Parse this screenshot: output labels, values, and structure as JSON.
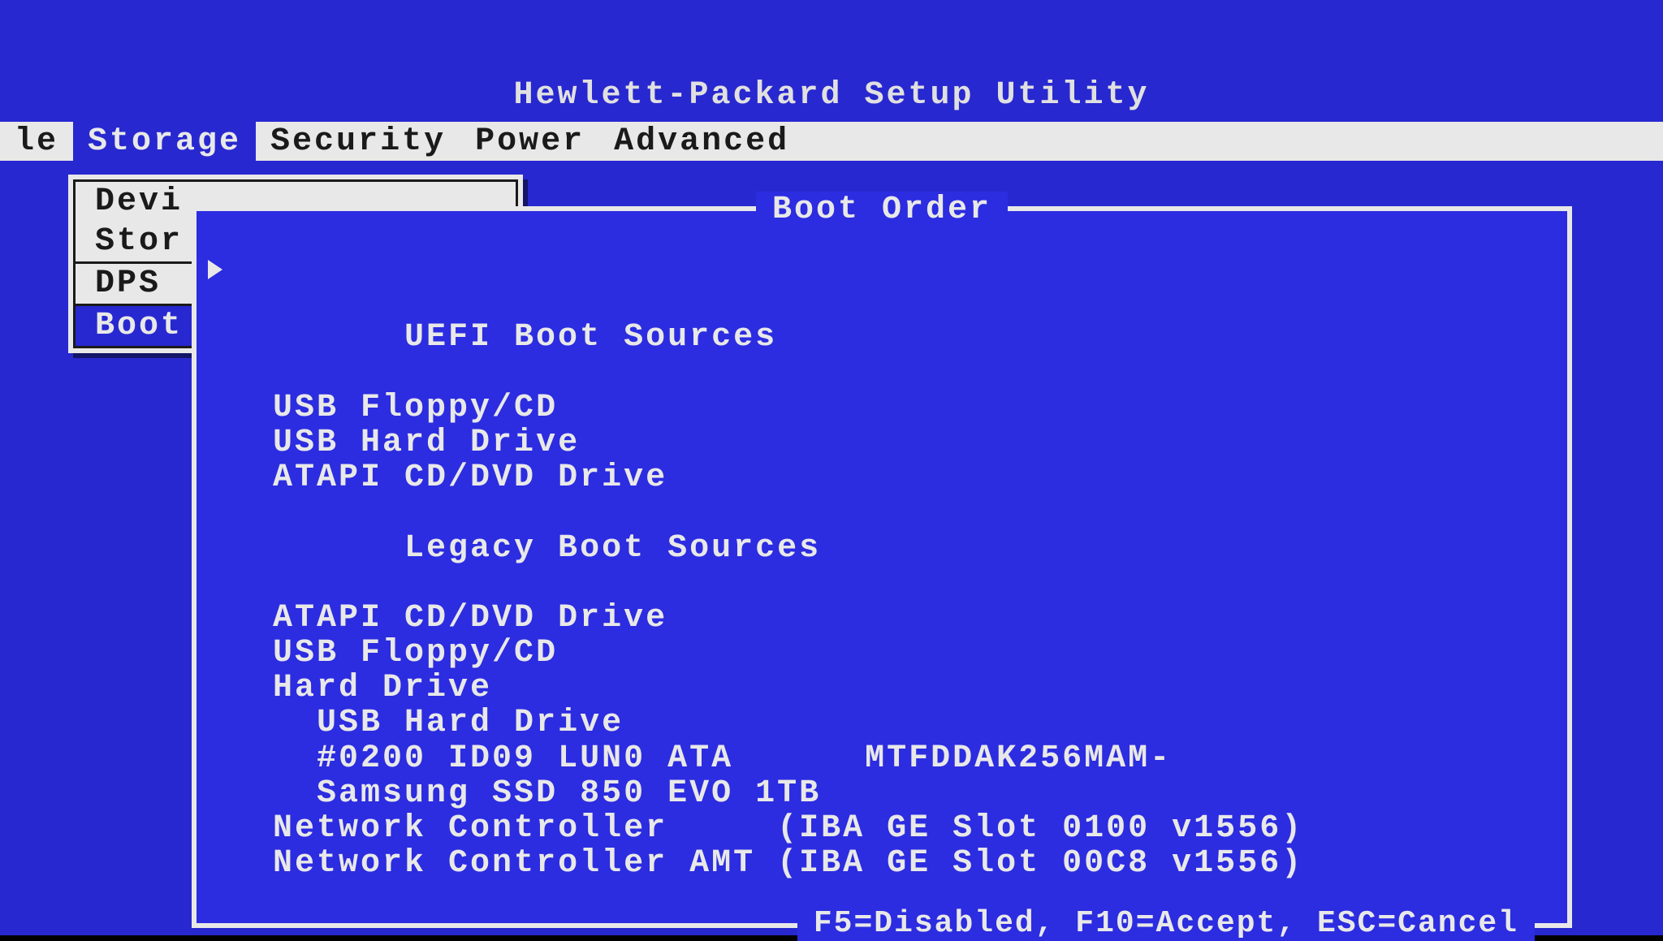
{
  "header": {
    "title": "Hewlett-Packard Setup Utility"
  },
  "menu": {
    "items": [
      "le",
      "Storage",
      "Security",
      "Power",
      "Advanced"
    ],
    "active_index": 1
  },
  "dropdown": {
    "items": [
      {
        "label": "Devi",
        "selected": false
      },
      {
        "label": "Stor",
        "selected": false
      },
      {
        "label": "DPS",
        "selected": false,
        "separator_before": true
      },
      {
        "label": "Boot",
        "selected": true,
        "separator_before": true
      }
    ]
  },
  "dialog": {
    "title": "Boot Order",
    "footer": "F5=Disabled, F10=Accept, ESC=Cancel",
    "groups": [
      {
        "label": "UEFI Boot Sources",
        "has_arrow": true,
        "items": [
          "USB Floppy/CD",
          "USB Hard Drive",
          "ATAPI CD/DVD Drive"
        ]
      },
      {
        "label": "Legacy Boot Sources",
        "has_arrow": false,
        "items": [
          "ATAPI CD/DVD Drive",
          "USB Floppy/CD",
          "Hard Drive",
          "  USB Hard Drive",
          "  #0200 ID09 LUN0 ATA      MTFDDAK256MAM-",
          "  Samsung SSD 850 EVO 1TB",
          "Network Controller     (IBA GE Slot 0100 v1556)",
          "Network Controller AMT (IBA GE Slot 00C8 v1556)"
        ]
      }
    ]
  }
}
